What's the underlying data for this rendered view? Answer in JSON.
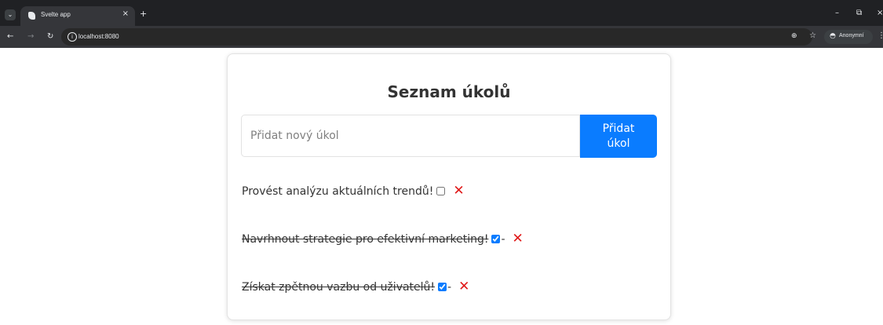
{
  "browser": {
    "tab": {
      "title": "Svelte app",
      "close": "×"
    },
    "new_tab": "+",
    "window_controls": {
      "minimize": "–",
      "restore": "⧉",
      "close": "×"
    },
    "address": {
      "url": "localhost:8080"
    },
    "profile_label": "Anonymní",
    "icons": [
      "tab-search-icon",
      "back-icon",
      "forward-icon",
      "reload-icon",
      "site-info-icon",
      "zoom-icon",
      "bookmark-star-icon",
      "incognito-icon",
      "menu-icon"
    ]
  },
  "app": {
    "title": "Seznam úkolů",
    "input": {
      "placeholder": "Přidat nový úkol",
      "value": ""
    },
    "add_button": "Přidat\núkol",
    "delete_symbol": "✕",
    "delete_color": "#e01919",
    "accent_color": "#0a7cff",
    "todos": [
      {
        "text": "Provést analýzu aktuálních trendů!",
        "done": false,
        "dash": ""
      },
      {
        "text": "Navrhnout strategie pro efektivní marketing!",
        "done": true,
        "dash": "-"
      },
      {
        "text": "Získat zpětnou vazbu od uživatelů!",
        "done": true,
        "dash": "-"
      }
    ]
  }
}
